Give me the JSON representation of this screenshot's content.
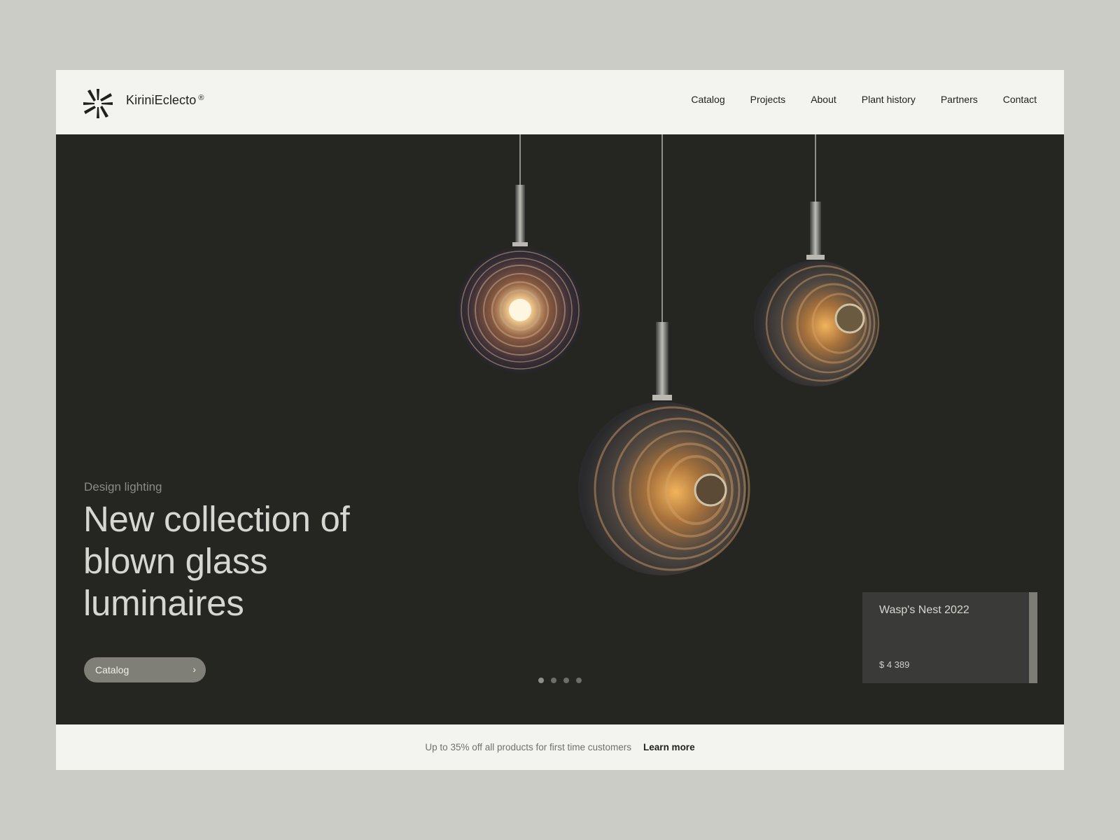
{
  "brand": {
    "name": "KiriniEclecto",
    "mark": "®"
  },
  "nav": {
    "items": [
      "Catalog",
      "Projects",
      "About",
      "Plant history",
      "Partners",
      "Contact"
    ]
  },
  "hero": {
    "eyebrow": "Design lighting",
    "headline": "New collection of blown glass luminaires",
    "cta_label": "Catalog",
    "cta_icon": "chevron-right-icon",
    "slides": {
      "count": 4,
      "active": 1
    }
  },
  "product_card": {
    "title": "Wasp's Nest 2022",
    "price": "$ 4 389"
  },
  "promo": {
    "text": "Up to 35% off all products for first time customers",
    "link": "Learn more"
  },
  "colors": {
    "page_bg": "#cbccc6",
    "frame_bg": "#f3f4ef",
    "hero_bg": "#252621",
    "cta_bg": "#7f7e77",
    "card_bg": "#3a3a38",
    "amber_glow": "#e8a24c"
  }
}
